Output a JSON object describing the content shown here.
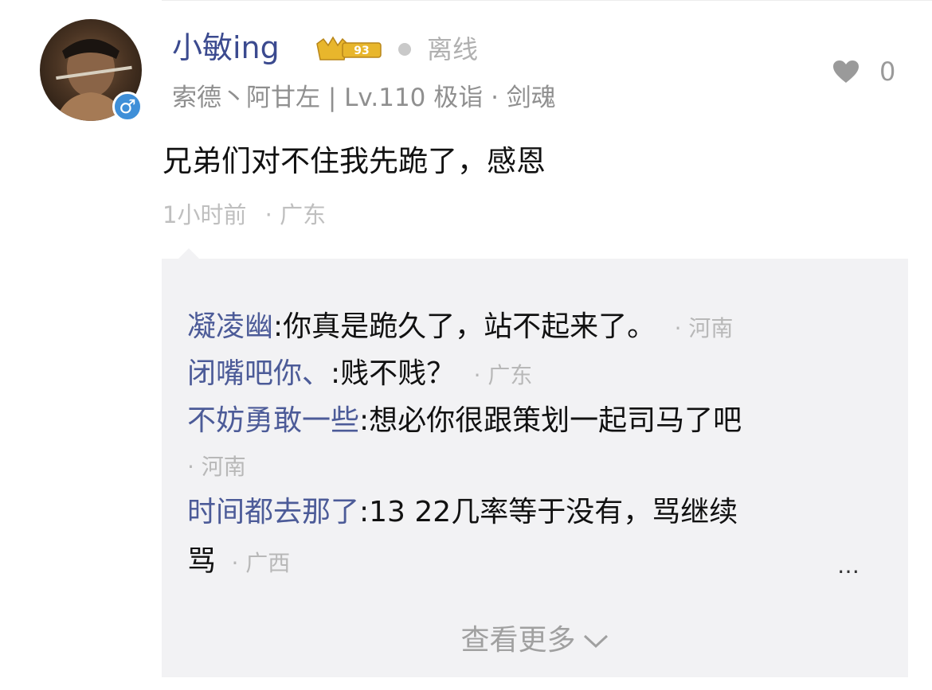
{
  "post": {
    "username": "小敏ing",
    "badge_level": "93",
    "status": "离线",
    "meta": "索德丶阿甘左 | Lv.110 极诣 · 剑魂",
    "content": "兄弟们对不住我先跪了，感恩",
    "time": "1小时前",
    "location": "· 广东",
    "like_count": "0",
    "gender_symbol": "♂",
    "icons": [
      "avatar",
      "male-icon",
      "level-badge-icon",
      "heart-icon",
      "chevron-down-icon"
    ]
  },
  "replies": [
    {
      "nick": "凝凌幽",
      "text": ":你真是跪久了，站不起来了。",
      "loc": "· 河南"
    },
    {
      "nick": "闭嘴吧你、",
      "text": ":贱不贱？",
      "loc": "· 广东"
    },
    {
      "nick": "不妨勇敢一些",
      "text": ":想必你很跟策划一起司马了吧",
      "loc": "· 河南"
    },
    {
      "nick": "时间都去那了",
      "text": ":13  22几率等于没有，骂继续",
      "text2": "骂",
      "loc": "· 广西"
    }
  ],
  "ellipsis": "…",
  "more_label": "查看更多",
  "colors": {
    "nickname": "#4c5b98",
    "username": "#3b4a8f",
    "reply_bg": "#f2f2f4",
    "gender_badge": "#3f8fd8",
    "level_badge": "#e8b62c"
  }
}
